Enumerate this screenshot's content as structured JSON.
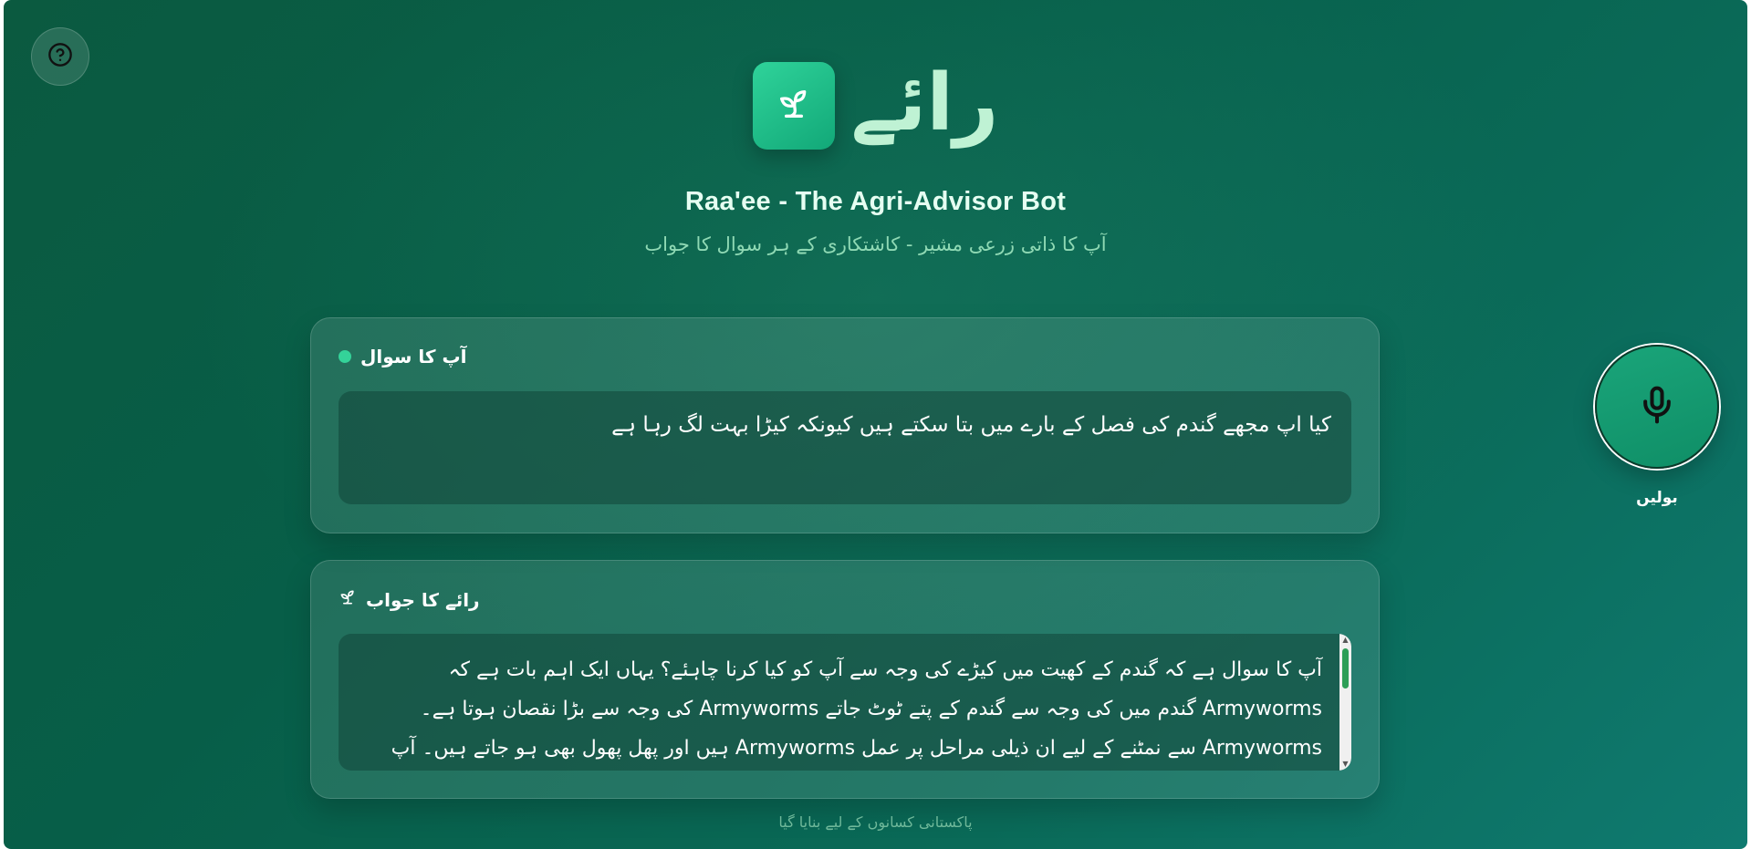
{
  "header": {
    "logo_text": "رائے",
    "title": "Raa'ee - The Agri-Advisor Bot",
    "subtitle": "آپ کا ذاتی زرعی مشیر - کاشتکاری کے ہر سوال کا جواب"
  },
  "help": {
    "icon": "question-circle-icon"
  },
  "question_card": {
    "label": "آپ کا سوال",
    "text": "کیا اپ مجھے گندم کی فصل کے بارے میں بتا سکتے ہیں کیونکہ کیڑا بہت لگ رہا ہے"
  },
  "answer_card": {
    "label": "رائے کا جواب",
    "icon": "sprout-icon",
    "text": "آپ کا سوال ہے کہ گندم کے کھیت میں کیڑے کی وجہ سے آپ کو کیا کرنا چاہئے؟ یہاں ایک اہم بات ہے کہ Armyworms گندم میں کی وجہ سے گندم کے پتے ٹوٹ جاتے Armyworms کی وجہ سے بڑا نقصان ہوتا ہے۔ Armyworms سے نمٹنے کے لیے ان ذیلی مراحل پر عمل Armyworms ہیں اور پھل پھول بھی ہو جاتے ہیں۔ آپ گندم میں"
  },
  "mic": {
    "label": "بولیں",
    "icon": "microphone-icon"
  },
  "footer": {
    "text": "پاکستانی کسانوں کے لیے بنایا گیا"
  },
  "colors": {
    "accent": "#34d399",
    "background": "#075e48",
    "title": "#e6fff2",
    "subtitle": "#8fd9b4"
  }
}
